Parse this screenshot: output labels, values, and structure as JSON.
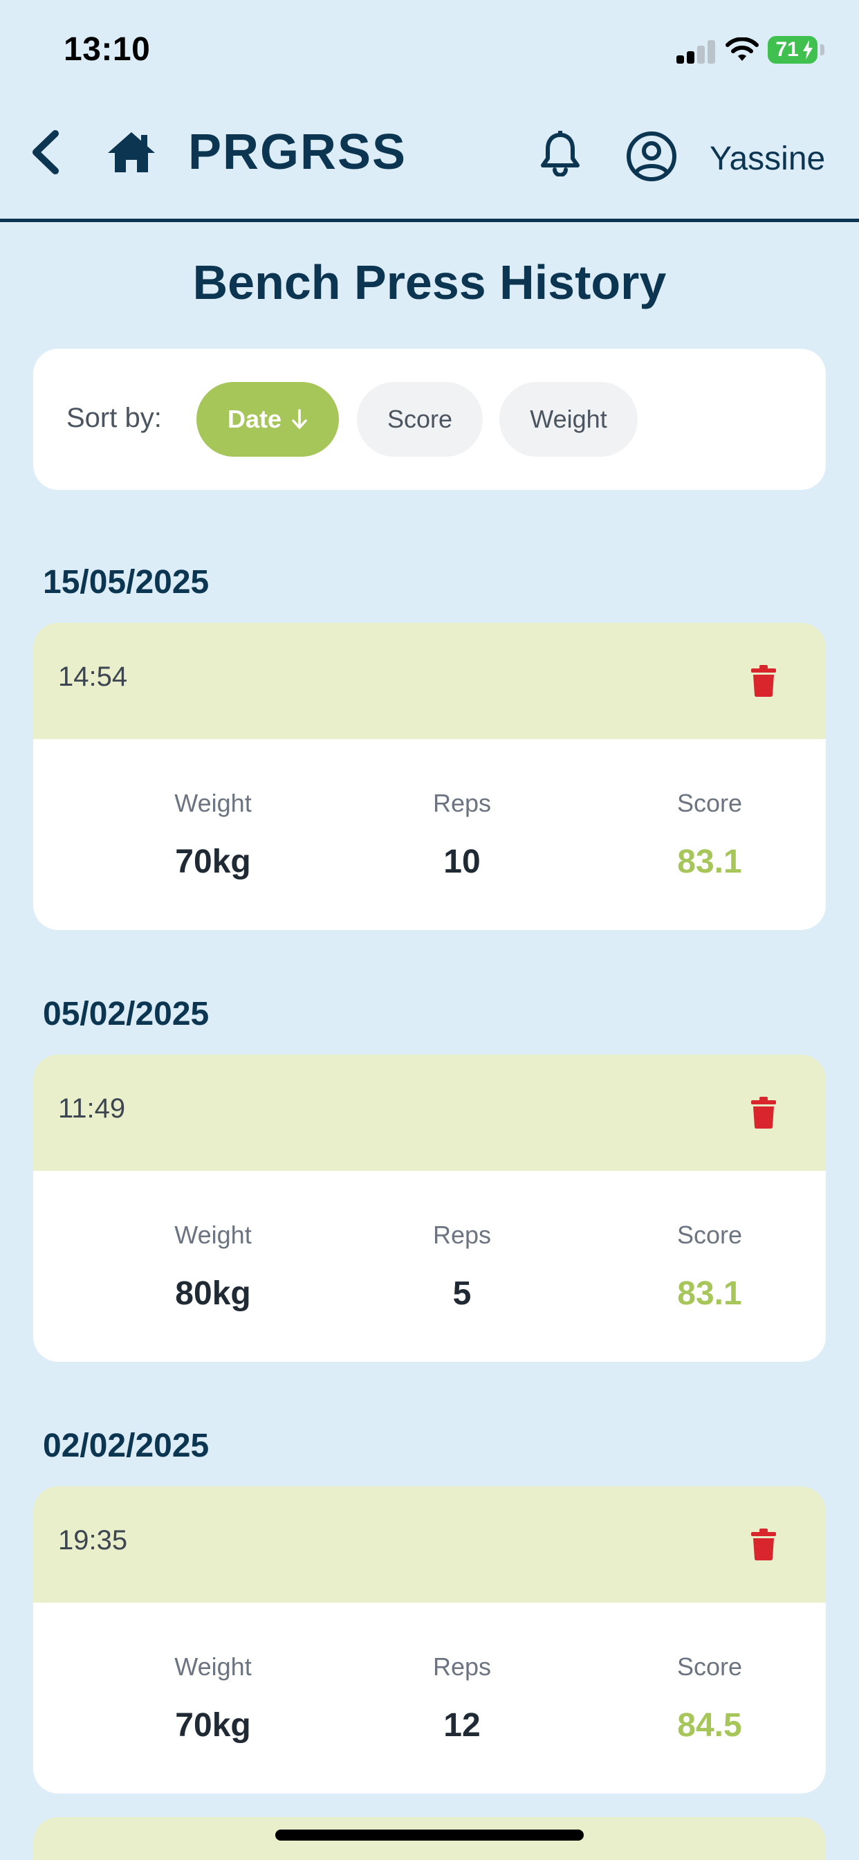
{
  "status_bar": {
    "time": "13:10",
    "battery": "71"
  },
  "header": {
    "brand": "PRGRSS",
    "username": "Yassine",
    "icons": {
      "back": "chevron-left-icon",
      "home": "home-icon",
      "notifications": "bell-icon",
      "profile": "user-circle-icon"
    }
  },
  "page": {
    "title": "Bench Press History"
  },
  "sort": {
    "label": "Sort by:",
    "options": [
      "Date",
      "Score",
      "Weight"
    ],
    "active": "Date",
    "direction": "descending"
  },
  "labels": {
    "weight": "Weight",
    "reps": "Reps",
    "score": "Score"
  },
  "sessions": [
    {
      "date": "15/05/2025",
      "time": "14:54",
      "weight": "70kg",
      "reps": "10",
      "score": "83.1"
    },
    {
      "date": "05/02/2025",
      "time": "11:49",
      "weight": "80kg",
      "reps": "5",
      "score": "83.1"
    },
    {
      "date": "02/02/2025",
      "time": "19:35",
      "weight": "70kg",
      "reps": "12",
      "score": "84.5"
    }
  ],
  "colors": {
    "background": "#dcedf7",
    "navy": "#0b3550",
    "accent_green": "#a6c65a",
    "card_header": "#e9eecb",
    "delete_red": "#d9262c"
  }
}
